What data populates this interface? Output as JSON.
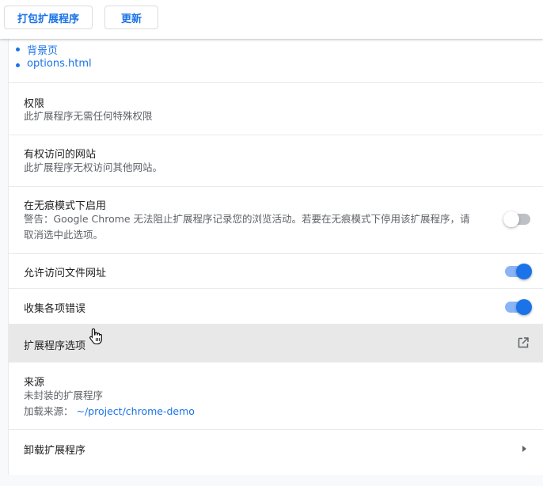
{
  "toolbar": {
    "pack_label": "打包扩展程序",
    "update_label": "更新"
  },
  "links": {
    "background_page": "背景页",
    "options_page": "options.html"
  },
  "permissions": {
    "title": "权限",
    "desc": "此扩展程序无需任何特殊权限"
  },
  "site_access": {
    "title": "有权访问的网站",
    "desc": "此扩展程序无权访问其他网站。"
  },
  "incognito": {
    "title": "在无痕模式下启用",
    "desc_line1": "警告：Google Chrome 无法阻止扩展程序记录您的浏览活动。若要在无痕模式下停用该扩展程序，请",
    "desc_line2": "取消选中此选项。",
    "enabled": false
  },
  "file_access": {
    "title": "允许访问文件网址",
    "enabled": true
  },
  "collect_errors": {
    "title": "收集各项错误",
    "enabled": true
  },
  "extension_options": {
    "title": "扩展程序选项"
  },
  "source": {
    "title": "来源",
    "desc": "未封装的扩展程序",
    "load_label": "加载来源：",
    "load_path": "~/project/chrome-demo"
  },
  "remove": {
    "title": "卸载扩展程序"
  },
  "colors": {
    "accent": "#1a73e8",
    "toggle_track_on": "#8ab4f8",
    "toggle_track_off": "#bdc1c6",
    "hover_row": "#e8e8e8"
  }
}
